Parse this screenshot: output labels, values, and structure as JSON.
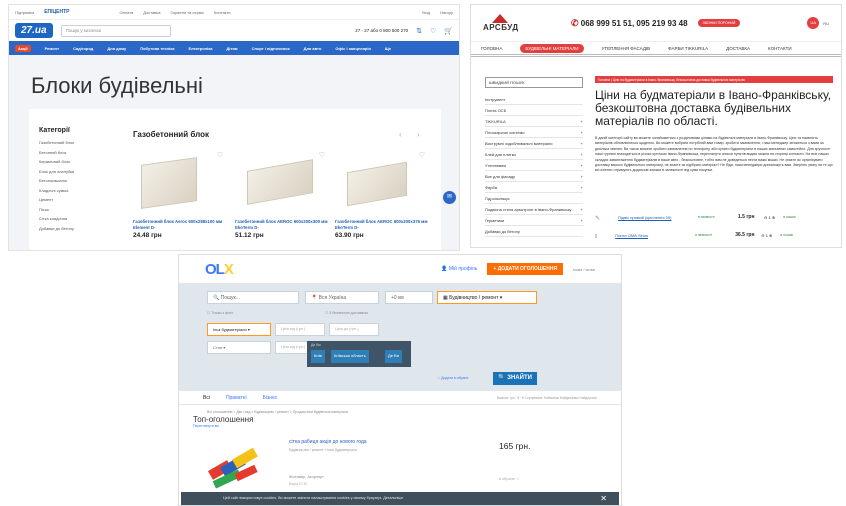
{
  "panel_a": {
    "top_links": [
      "Підтримка",
      "ЕПІЦЕНТР",
      "Оплата",
      "Доставка",
      "Гарантія та сервіс",
      "Контакти",
      "Вхід",
      "Нагору"
    ],
    "logo": "27.ua",
    "search_placeholder": "Пошук у каталозі",
    "phone": "27 · 27 або 0 800 500 270",
    "nav": [
      "Акції",
      "Ремонт",
      "Сад/город",
      "Для дому",
      "Побутова техніка",
      "Електроніка",
      "Дітям",
      "Спорт і відпочинок",
      "Для авто",
      "Офіс і канцелярія",
      "Ще"
    ],
    "page_title": "Блоки будівельні",
    "categories_title": "Категорії",
    "categories": [
      "Газобетонний блок",
      "Бетонний блок",
      "Керамічний блок",
      "Блок для опалубки",
      "Бетонокашалоі",
      "Кладочні суміші",
      "Цемент",
      "Пісок",
      "Сітка кладочна",
      "Добавки до бетону"
    ],
    "section_title": "Газобетонний блок",
    "products": [
      {
        "name": "Газобетонний блок Aeroc 600x288x100 мм Element D-",
        "price": "24.48 грн"
      },
      {
        "name": "Газобетонний блок AEROC 600x200x300 мм EkoTerm D-",
        "price": "51.12 грн"
      },
      {
        "name": "Газобетонний блок AEROC 600x200x375 мм EkoTerm D-",
        "price": "63.90 грн"
      }
    ]
  },
  "panel_b": {
    "logo": "АРСБУД",
    "phones": "068 999 51 51, 095 219 93 48",
    "call_button": "ЗВОНКИ ПОРОНИЙ",
    "lang_active": "UA",
    "lang_other": "RU",
    "nav": [
      "ГОЛОВНА",
      "БУДІВЕЛЬНІ МАТЕРІАЛИ",
      "УТЕПЛЕННЯ ФАСАДІВ",
      "ФАРБИ TIKKURILA",
      "ДОСТАВКА",
      "КОНТАКТИ"
    ],
    "search_value": "ШВИДКИЙ ПОШУК",
    "sidebar": [
      "Інструмент",
      "Плита OCБ",
      "TIKKURILA",
      "Плоскарочні системи",
      "Виструмні оздоблювальні матеріали",
      "Клей для плитки",
      "Утеплювачі",
      "Все для фасаду",
      "Фарба",
      "Гідроізоляція",
      "Подвісна стеля армстронг в Івано-Франківську",
      "Герметики",
      "Добавки до бетону"
    ],
    "breadcrumb": "Головна  |  Ціни на будматеріали в Івано-Франківську, безкоштовна доставка будівельних матеріалів",
    "heading": "Ціни на будматеріали в Івано-Франківську, безкоштовна доставка будівельних матеріалів по області.",
    "body_text": "В даній категорії сайту ви можете ознайомитися з розділовими цінами на будівельні матеріали в Івано-Франківську. Ціни та наявність матеріалів обновлюються щоденно. Ви можете вибрати потрібний вам товар, зробити замовлення, і наш менеджер зв'яжеться з вами за декілька хвилин. Ви також можете зробити замовлення по телефону, або купити будматеріали в наших магазинах самостійно. Для зручності наші гуртівні знаходяться в різних куточках Івано-Франківська, переглянути список пунктів видачі можна на сторінці контакти. На всіх наших складах завантаження будматеріалів в ваше авто - безкоштовне, тобто вам не доведеться нести важкі мішки. Не знаєте як організувати доставку вашого будівельного матеріалу, не знаєте як підібрати матеріал? Не біда, наші менеджери допоможуть вам. Зверніть увагу на те що всі клієнти отримують додаткові знижки в залежності від суми покупки.",
    "rows": [
      {
        "name": "Підвіс прямий (кріплення 05)",
        "status": "в наявності",
        "price": "1.5 грн",
        "qty": "1",
        "buy": "в кошик"
      },
      {
        "name": "Плита ОМА Sirius",
        "status": "в наявності",
        "price": "36.5 грн",
        "qty": "1",
        "buy": "в кошик"
      }
    ]
  },
  "panel_c": {
    "logo_a": "OL",
    "logo_b": "X",
    "profile": "Мій профіль",
    "add_button": "+ ДОДАТИ ОГОЛОШЕННЯ",
    "langs": "мова / мови",
    "search_placeholder": "Пошук...",
    "region": "Вся Україна",
    "radius": "+0 км",
    "category": "Будівництво / ремонт",
    "subcategory": "Інші будматеріали",
    "price_from": "Ціна від (грн.)",
    "price_to": "Ціна до (грн.)",
    "status_sel": "Стан",
    "popup_header": "Де Ви",
    "popup_buttons": [
      "Київ",
      "Київська область",
      "Де Ви"
    ],
    "only_photo": "Тільки з фото",
    "with_delivery": "З безпечною доставкою",
    "save_search": "Додати в обране",
    "search_button": "ЗНАЙТИ",
    "tabs": [
      "Всі",
      "Приватні",
      "Бізнес"
    ],
    "sort": "Валюта: грн · $ · €   Сортування: Найновіші  Найдешевші  Найдорожчі",
    "breadcrumb": "Всі оголошення  >  Дім і сад  >  Будівництво / ремонт  >  Продам інші будівельні матеріали",
    "top_title": "Топ-оголошення",
    "top_sub": "Переглянути всі",
    "ad": {
      "title": "сітка рабиця акція до нового года",
      "category": "Будівництво / ремонт » Інші будматеріали",
      "location": "Житомир, Акорлорт",
      "date": "Вчора 07:30",
      "price": "165 грн.",
      "fav": "в обране"
    },
    "cookie": "Цей сайт використовує cookies. Ви можете змінити налаштування cookies у своєму браузері. Детальніше",
    "price2": "100 грн."
  }
}
